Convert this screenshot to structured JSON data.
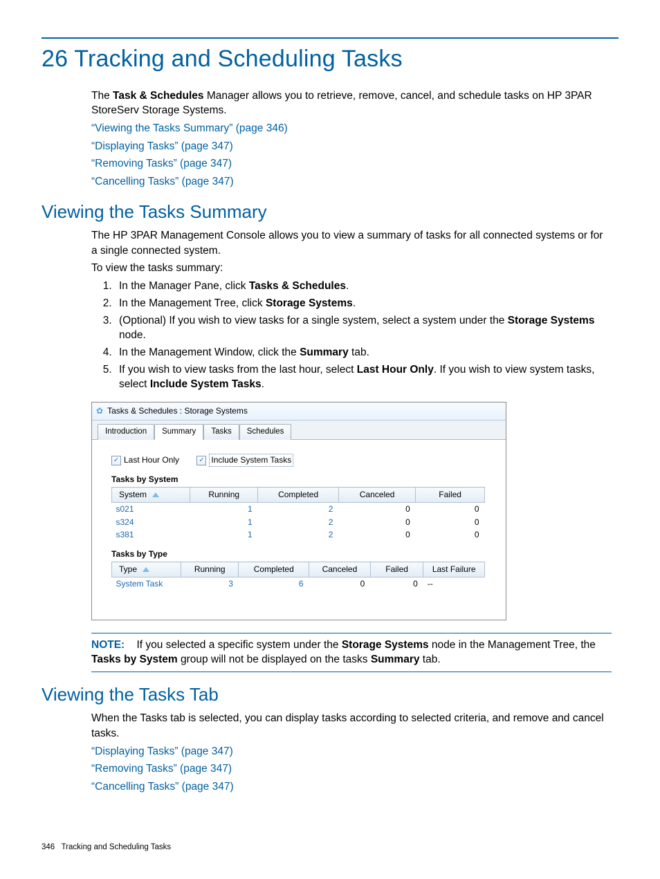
{
  "chapter": {
    "number": "26",
    "title": "Tracking and Scheduling Tasks"
  },
  "intro": {
    "prefix": "The ",
    "bold1": "Task & Schedules",
    "rest": " Manager allows you to retrieve, remove, cancel, and schedule tasks on HP 3PAR StoreServ Storage Systems."
  },
  "xrefs_top": [
    "“Viewing the Tasks Summary” (page 346)",
    "“Displaying Tasks” (page 347)",
    "“Removing Tasks” (page 347)",
    "“Cancelling Tasks” (page 347)"
  ],
  "section1": {
    "title": "Viewing the Tasks Summary",
    "p1": "The HP 3PAR Management Console allows you to view a summary of tasks for all connected systems or for a single connected system.",
    "p2": "To view the tasks summary:",
    "steps": {
      "s1_a": "In the Manager Pane, click ",
      "s1_b": "Tasks & Schedules",
      "s1_c": ".",
      "s2_a": "In the Management Tree, click ",
      "s2_b": "Storage Systems",
      "s2_c": ".",
      "s3_a": "(Optional) If you wish to view tasks for a single system, select a system under the ",
      "s3_b": "Storage Systems",
      "s3_c": " node.",
      "s4_a": "In the Management Window, click the ",
      "s4_b": "Summary",
      "s4_c": " tab.",
      "s5_a": "If you wish to view tasks from the last hour, select ",
      "s5_b": "Last Hour Only",
      "s5_c": ". If you wish to view system tasks, select ",
      "s5_d": "Include System Tasks",
      "s5_e": "."
    }
  },
  "screenshot": {
    "title": "Tasks & Schedules : Storage Systems",
    "tabs": [
      "Introduction",
      "Summary",
      "Tasks",
      "Schedules"
    ],
    "active_tab_index": 1,
    "checkboxes": {
      "lastHour": {
        "label": "Last Hour Only",
        "checked": true
      },
      "includeSys": {
        "label": "Include System Tasks",
        "checked": true
      }
    },
    "tasks_by_system": {
      "heading": "Tasks by System",
      "columns": [
        "System",
        "Running",
        "Completed",
        "Canceled",
        "Failed"
      ],
      "rows": [
        {
          "system": "s021",
          "running": "1",
          "completed": "2",
          "canceled": "0",
          "failed": "0"
        },
        {
          "system": "s324",
          "running": "1",
          "completed": "2",
          "canceled": "0",
          "failed": "0"
        },
        {
          "system": "s381",
          "running": "1",
          "completed": "2",
          "canceled": "0",
          "failed": "0"
        }
      ]
    },
    "tasks_by_type": {
      "heading": "Tasks by Type",
      "columns": [
        "Type",
        "Running",
        "Completed",
        "Canceled",
        "Failed",
        "Last Failure"
      ],
      "rows": [
        {
          "type": "System Task",
          "running": "3",
          "completed": "6",
          "canceled": "0",
          "failed": "0",
          "last": "--"
        }
      ]
    }
  },
  "note": {
    "label": "NOTE:",
    "a": "If you selected a specific system under the ",
    "b": "Storage Systems",
    "c": " node in the Management Tree, the ",
    "d": "Tasks by System",
    "e": " group will not be displayed on the tasks ",
    "f": "Summary",
    "g": " tab."
  },
  "section2": {
    "title": "Viewing the Tasks Tab",
    "p1": "When the Tasks tab is selected, you can display tasks according to selected criteria, and remove and cancel tasks."
  },
  "xrefs_bottom": [
    "“Displaying Tasks” (page 347)",
    "“Removing Tasks” (page 347)",
    "“Cancelling Tasks” (page 347)"
  ],
  "footer": {
    "pagenum": "346",
    "label": "Tracking and Scheduling Tasks"
  }
}
